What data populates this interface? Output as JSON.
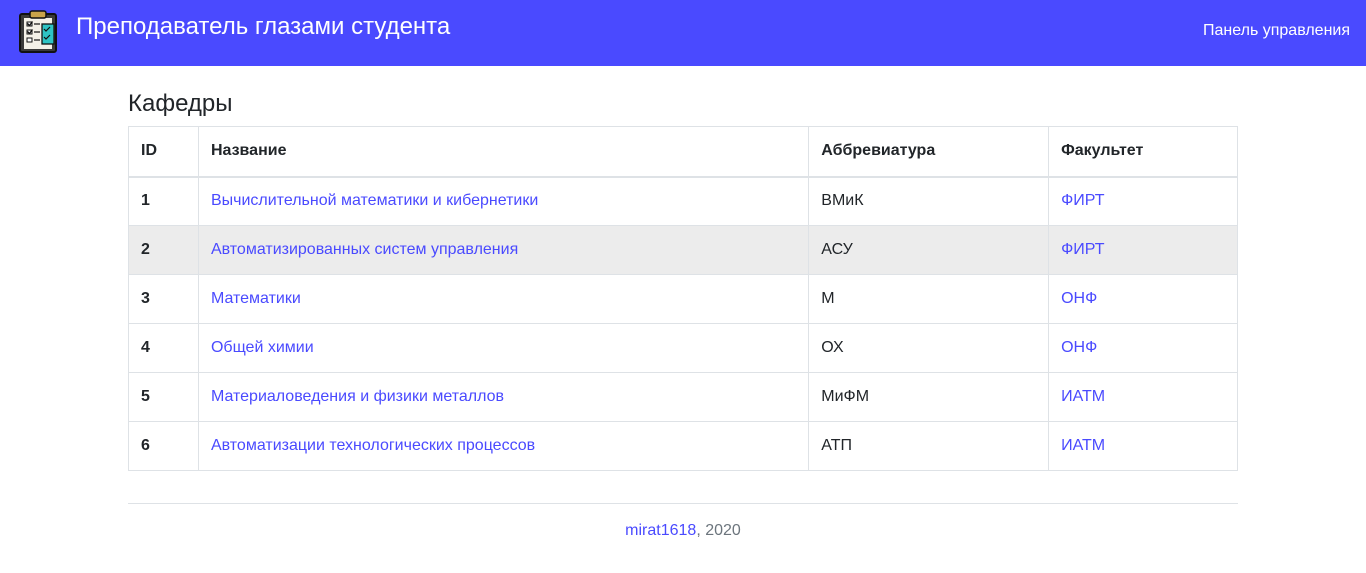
{
  "header": {
    "title": "Преподаватель глазами студента",
    "nav_link": "Панель управления",
    "logo_icon": "clipboard-checklist-icon",
    "background_color": "#4a4aff"
  },
  "main": {
    "heading": "Кафедры",
    "table": {
      "columns": [
        "ID",
        "Название",
        "Аббревиатура",
        "Факультет"
      ],
      "rows": [
        {
          "id": "1",
          "name": "Вычислительной математики и кибернетики",
          "abbr": "ВМиК",
          "faculty": "ФИРТ"
        },
        {
          "id": "2",
          "name": "Автоматизированных систем управления",
          "abbr": "АСУ",
          "faculty": "ФИРТ"
        },
        {
          "id": "3",
          "name": "Математики",
          "abbr": "М",
          "faculty": "ОНФ"
        },
        {
          "id": "4",
          "name": "Общей химии",
          "abbr": "ОХ",
          "faculty": "ОНФ"
        },
        {
          "id": "5",
          "name": "Материаловедения и физики металлов",
          "abbr": "МиФМ",
          "faculty": "ИАТМ"
        },
        {
          "id": "6",
          "name": "Автоматизации технологических процессов",
          "abbr": "АТП",
          "faculty": "ИАТМ"
        }
      ],
      "highlighted_row": "2"
    }
  },
  "footer": {
    "author": "mirat1618",
    "year_suffix": ", 2020"
  },
  "colors": {
    "accent": "#4a4aff",
    "row_highlight": "#ececec"
  }
}
